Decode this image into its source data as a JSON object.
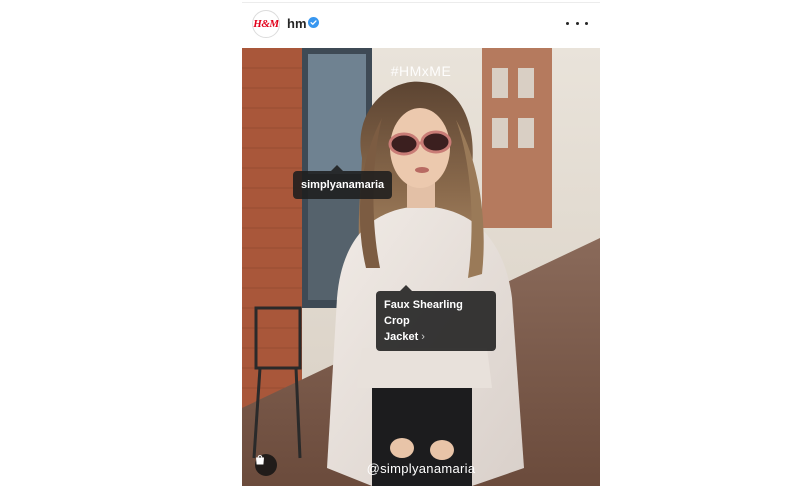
{
  "post": {
    "username": "hm",
    "verified": true,
    "avatar_logo": "H&M",
    "more_icon": "more-horizontal-icon",
    "overlay_hashtag": "#HMxME",
    "overlay_handle": "@simplyanamaria",
    "tags": {
      "user": "simplyanamaria",
      "product_line1": "Faux Shearling Crop",
      "product_line2": "Jacket"
    },
    "shop_icon": "shopping-bag-icon",
    "colors": {
      "brand_red": "#e2001a",
      "verified_blue": "#3897f0",
      "tag_bg": "#1e1e1e"
    }
  }
}
